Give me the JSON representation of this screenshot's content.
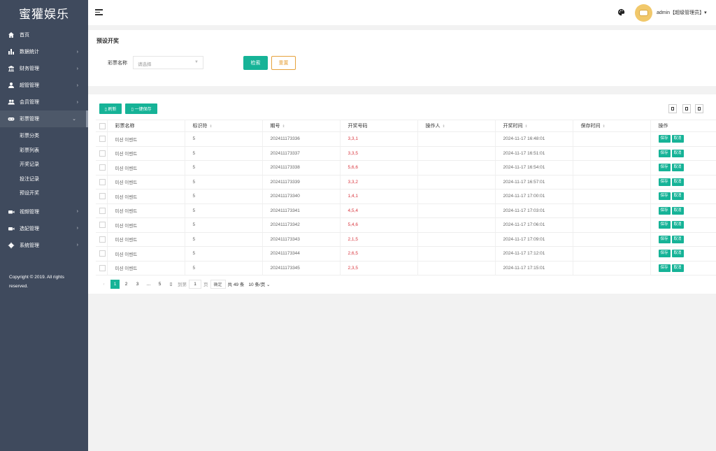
{
  "brand": "蜜獾娱乐",
  "sidebar": {
    "items": [
      {
        "label": "首页",
        "icon": "home-icon",
        "arrow": ""
      },
      {
        "label": "数据统计",
        "icon": "bar-chart-icon",
        "arrow": "›"
      },
      {
        "label": "财务管理",
        "icon": "bank-icon",
        "arrow": "›"
      },
      {
        "label": "超管管理",
        "icon": "user-icon",
        "arrow": "›"
      },
      {
        "label": "会员管理",
        "icon": "users-icon",
        "arrow": "›"
      },
      {
        "label": "彩票管理",
        "icon": "gamepad-icon",
        "arrow": "⌄"
      }
    ],
    "subitems": [
      "彩票分类",
      "彩票列表",
      "开奖记录",
      "投注记录",
      "预设开奖"
    ],
    "items_after": [
      {
        "label": "视频管理",
        "icon": "video-icon",
        "arrow": "›"
      },
      {
        "label": "选妃管理",
        "icon": "video-icon",
        "arrow": "›"
      },
      {
        "label": "系统管理",
        "icon": "gear-icon",
        "arrow": "›"
      }
    ],
    "copyright": "Copyright © 2019. All rights reserved."
  },
  "header": {
    "user": "admin【超级管理员】▾"
  },
  "search": {
    "title": "预设开奖",
    "field_label": "彩票名称",
    "placeholder": "请选择",
    "search_btn": "检索",
    "reset_btn": "重置"
  },
  "toolbar": {
    "refresh_btn": "▯ 刷新",
    "save_all_btn": "▯ 一键保存"
  },
  "table": {
    "columns": [
      "彩票名称",
      "标识符",
      "期号",
      "开奖号码",
      "操作人",
      "开奖时间",
      "保存时间",
      "操作"
    ],
    "sortable": [
      false,
      true,
      true,
      false,
      true,
      true,
      true,
      false
    ],
    "op_save": "保存",
    "op_cancel": "取消",
    "rows": [
      {
        "name": "미션 이벤트",
        "key": "5",
        "issue": "202411173336",
        "numbers": "3,3,1",
        "operator": "",
        "time": "2024-11-17 16:48:01",
        "saved": ""
      },
      {
        "name": "미션 이벤트",
        "key": "5",
        "issue": "202411173337",
        "numbers": "3,3,5",
        "operator": "",
        "time": "2024-11-17 16:51:01",
        "saved": ""
      },
      {
        "name": "미션 이벤트",
        "key": "5",
        "issue": "202411173338",
        "numbers": "5,6,6",
        "operator": "",
        "time": "2024-11-17 16:54:01",
        "saved": ""
      },
      {
        "name": "미션 이벤트",
        "key": "5",
        "issue": "202411173339",
        "numbers": "3,3,2",
        "operator": "",
        "time": "2024-11-17 16:57:01",
        "saved": ""
      },
      {
        "name": "미션 이벤트",
        "key": "5",
        "issue": "202411173340",
        "numbers": "1,4,1",
        "operator": "",
        "time": "2024-11-17 17:00:01",
        "saved": ""
      },
      {
        "name": "미션 이벤트",
        "key": "5",
        "issue": "202411173341",
        "numbers": "4,5,4",
        "operator": "",
        "time": "2024-11-17 17:03:01",
        "saved": ""
      },
      {
        "name": "미션 이벤트",
        "key": "5",
        "issue": "202411173342",
        "numbers": "5,4,6",
        "operator": "",
        "time": "2024-11-17 17:06:01",
        "saved": ""
      },
      {
        "name": "미션 이벤트",
        "key": "5",
        "issue": "202411173343",
        "numbers": "2,1,5",
        "operator": "",
        "time": "2024-11-17 17:09:01",
        "saved": ""
      },
      {
        "name": "미션 이벤트",
        "key": "5",
        "issue": "202411173344",
        "numbers": "2,6,5",
        "operator": "",
        "time": "2024-11-17 17:12:01",
        "saved": ""
      },
      {
        "name": "미션 이벤트",
        "key": "5",
        "issue": "202411173345",
        "numbers": "2,3,5",
        "operator": "",
        "time": "2024-11-17 17:15:01",
        "saved": ""
      }
    ]
  },
  "pager": {
    "prev": "‹",
    "pages": [
      "1",
      "2",
      "3",
      "…",
      "5"
    ],
    "next": "▯",
    "goto_label": "到第",
    "page_value": "1",
    "page_suffix": "页",
    "confirm": "确定",
    "total": "共 49 条",
    "page_size": "10 条/页 ⌄"
  },
  "colors": {
    "sidebar": "#3f4a5d",
    "accent": "#16b397",
    "reset": "#e6a23c",
    "lottery_number": "#d9363e"
  }
}
